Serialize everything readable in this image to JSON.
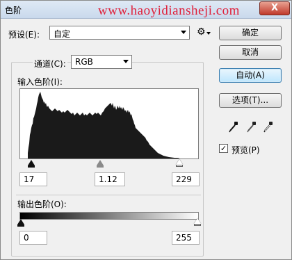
{
  "window": {
    "title": "色阶",
    "watermark": "www.haoyidiansheji.com",
    "close_label": "X"
  },
  "preset": {
    "label": "预设(E):",
    "value": "自定"
  },
  "channel": {
    "label": "通道(C):",
    "value": "RGB"
  },
  "input_levels": {
    "label": "输入色阶(I):",
    "black": "17",
    "gamma": "1.12",
    "white": "229"
  },
  "output_levels": {
    "label": "输出色阶(O):",
    "black": "0",
    "white": "255"
  },
  "buttons": {
    "ok": "确定",
    "cancel": "取消",
    "auto": "自动(A)",
    "options": "选项(T)..."
  },
  "preview": {
    "label": "预览(P)",
    "checked": true
  },
  "icons": {
    "gear": "gear-icon",
    "eyedroppers": [
      "black-eyedropper-icon",
      "gray-eyedropper-icon",
      "white-eyedropper-icon"
    ]
  }
}
